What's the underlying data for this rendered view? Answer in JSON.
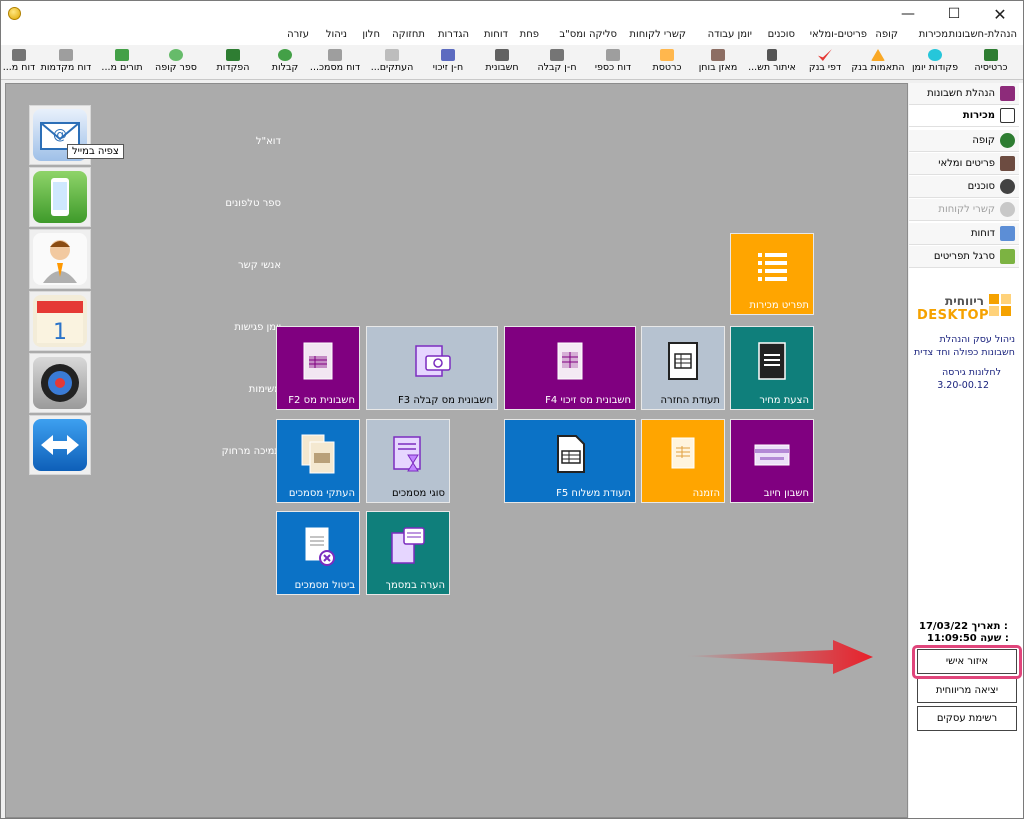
{
  "window": {
    "minimize_icon": "minimize-icon",
    "maximize_icon": "maximize-icon",
    "close_icon": "close-icon"
  },
  "menu": [
    "הנהלת-חשבונות",
    "מכירות",
    "קופה",
    "פריטים-ומלאי",
    "סוכנים",
    "יומן עבודה",
    "קשרי לקוחות",
    "סליקה ומס\"ב",
    "פחת",
    "דוחות",
    "הגדרות",
    "תחזוקה",
    "חלון",
    "ניהול",
    "עזרה"
  ],
  "toolbar": [
    "כרטיסיה",
    "פקודות יומן",
    "התאמות בנק",
    "דפי בנק",
    "איתור תש...",
    "מאזן בוחן",
    "כרטסת",
    "דוח כספי",
    "ח-ן קבלה",
    "חשבונית",
    "ח-ן זיכוי",
    "העתקים...",
    "דוח מסמכ...",
    "קבלות",
    "הפקדות",
    "ספר קופה",
    "תורים מ...",
    "דוח מקדמות",
    "דוח מ..."
  ],
  "side_apps": [
    {
      "label": "דוא\"ל",
      "icon": "email-icon"
    },
    {
      "label": "ספר טלפונים",
      "icon": "phone-icon"
    },
    {
      "label": "אנשי קשר",
      "icon": "contact-person-icon"
    },
    {
      "label": "יומן פגישות",
      "icon": "calendar-icon"
    },
    {
      "label": "משימות",
      "icon": "target-icon"
    },
    {
      "label": "תמיכה מרחוק",
      "icon": "remote-support-icon"
    }
  ],
  "tooltip": "צפיה במייל",
  "tiles": [
    {
      "label": "תפריט מכירות",
      "color": "#ffa500",
      "icon": "list-icon"
    },
    {
      "label": "חשבונית מס F2",
      "color": "#800080",
      "icon": "invoice-icon"
    },
    {
      "label": "חשבונית מס קבלה F3",
      "color": "#b6c2d0",
      "icon": "receipt-invoice-icon"
    },
    {
      "label": "חשבונית מס זיכוי F4",
      "color": "#800080",
      "icon": "credit-invoice-icon"
    },
    {
      "label": "תעודת החזרה",
      "color": "#b6c2d0",
      "icon": "return-doc-icon"
    },
    {
      "label": "הצעת מחיר",
      "color": "#0f7f7b",
      "icon": "quote-icon"
    },
    {
      "label": "העתקי מסמכים",
      "color": "#0b72c6",
      "icon": "copies-icon"
    },
    {
      "label": "סוגי מסמכים",
      "color": "#b6c2d0",
      "icon": "doc-types-icon"
    },
    {
      "label": "תעודת משלוח F5",
      "color": "#0b72c6",
      "icon": "delivery-note-icon"
    },
    {
      "label": "הזמנה",
      "color": "#ffa500",
      "icon": "order-icon"
    },
    {
      "label": "חשבון חיוב",
      "color": "#800080",
      "icon": "charge-account-icon"
    },
    {
      "label": "ביטול מסמכים",
      "color": "#0b72c6",
      "icon": "cancel-doc-icon"
    },
    {
      "label": "הערה במסמך",
      "color": "#0f7f7b",
      "icon": "doc-note-icon"
    }
  ],
  "right_panel": {
    "items": [
      {
        "label": "הנהלת חשבונות",
        "icon": "accounting-icon",
        "state": "normal"
      },
      {
        "label": "מכירות",
        "icon": "sales-icon",
        "state": "active"
      },
      {
        "label": "קופה",
        "icon": "cash-register-icon",
        "state": "normal"
      },
      {
        "label": "פריטים ומלאי",
        "icon": "inventory-icon",
        "state": "normal"
      },
      {
        "label": "סוכנים",
        "icon": "agents-icon",
        "state": "normal"
      },
      {
        "label": "קשרי לקוחות",
        "icon": "crm-icon",
        "state": "disabled"
      },
      {
        "label": "דוחות",
        "icon": "reports-icon",
        "state": "normal"
      },
      {
        "label": "סרגל תפריטים",
        "icon": "menu-bar-icon",
        "state": "normal"
      }
    ],
    "logo_he": "ריווחית",
    "logo_en": "DESKTOP",
    "desc1": "ניהול עסק והנהלת",
    "desc2": "חשבונות כפולה וחד צדית",
    "version_label": "לחלונות גירסה",
    "version": "3.20-00.12",
    "date_label": "תאריך :",
    "date": "17/03/22",
    "time_label": "שעה :",
    "time": "11:09:50",
    "buttons": [
      "איזור אישי",
      "יציאה מריווחית",
      "רשימת עסקים"
    ]
  },
  "annotation": {
    "highlight_color": "#e0457b",
    "arrow_color": "#e8202a"
  }
}
